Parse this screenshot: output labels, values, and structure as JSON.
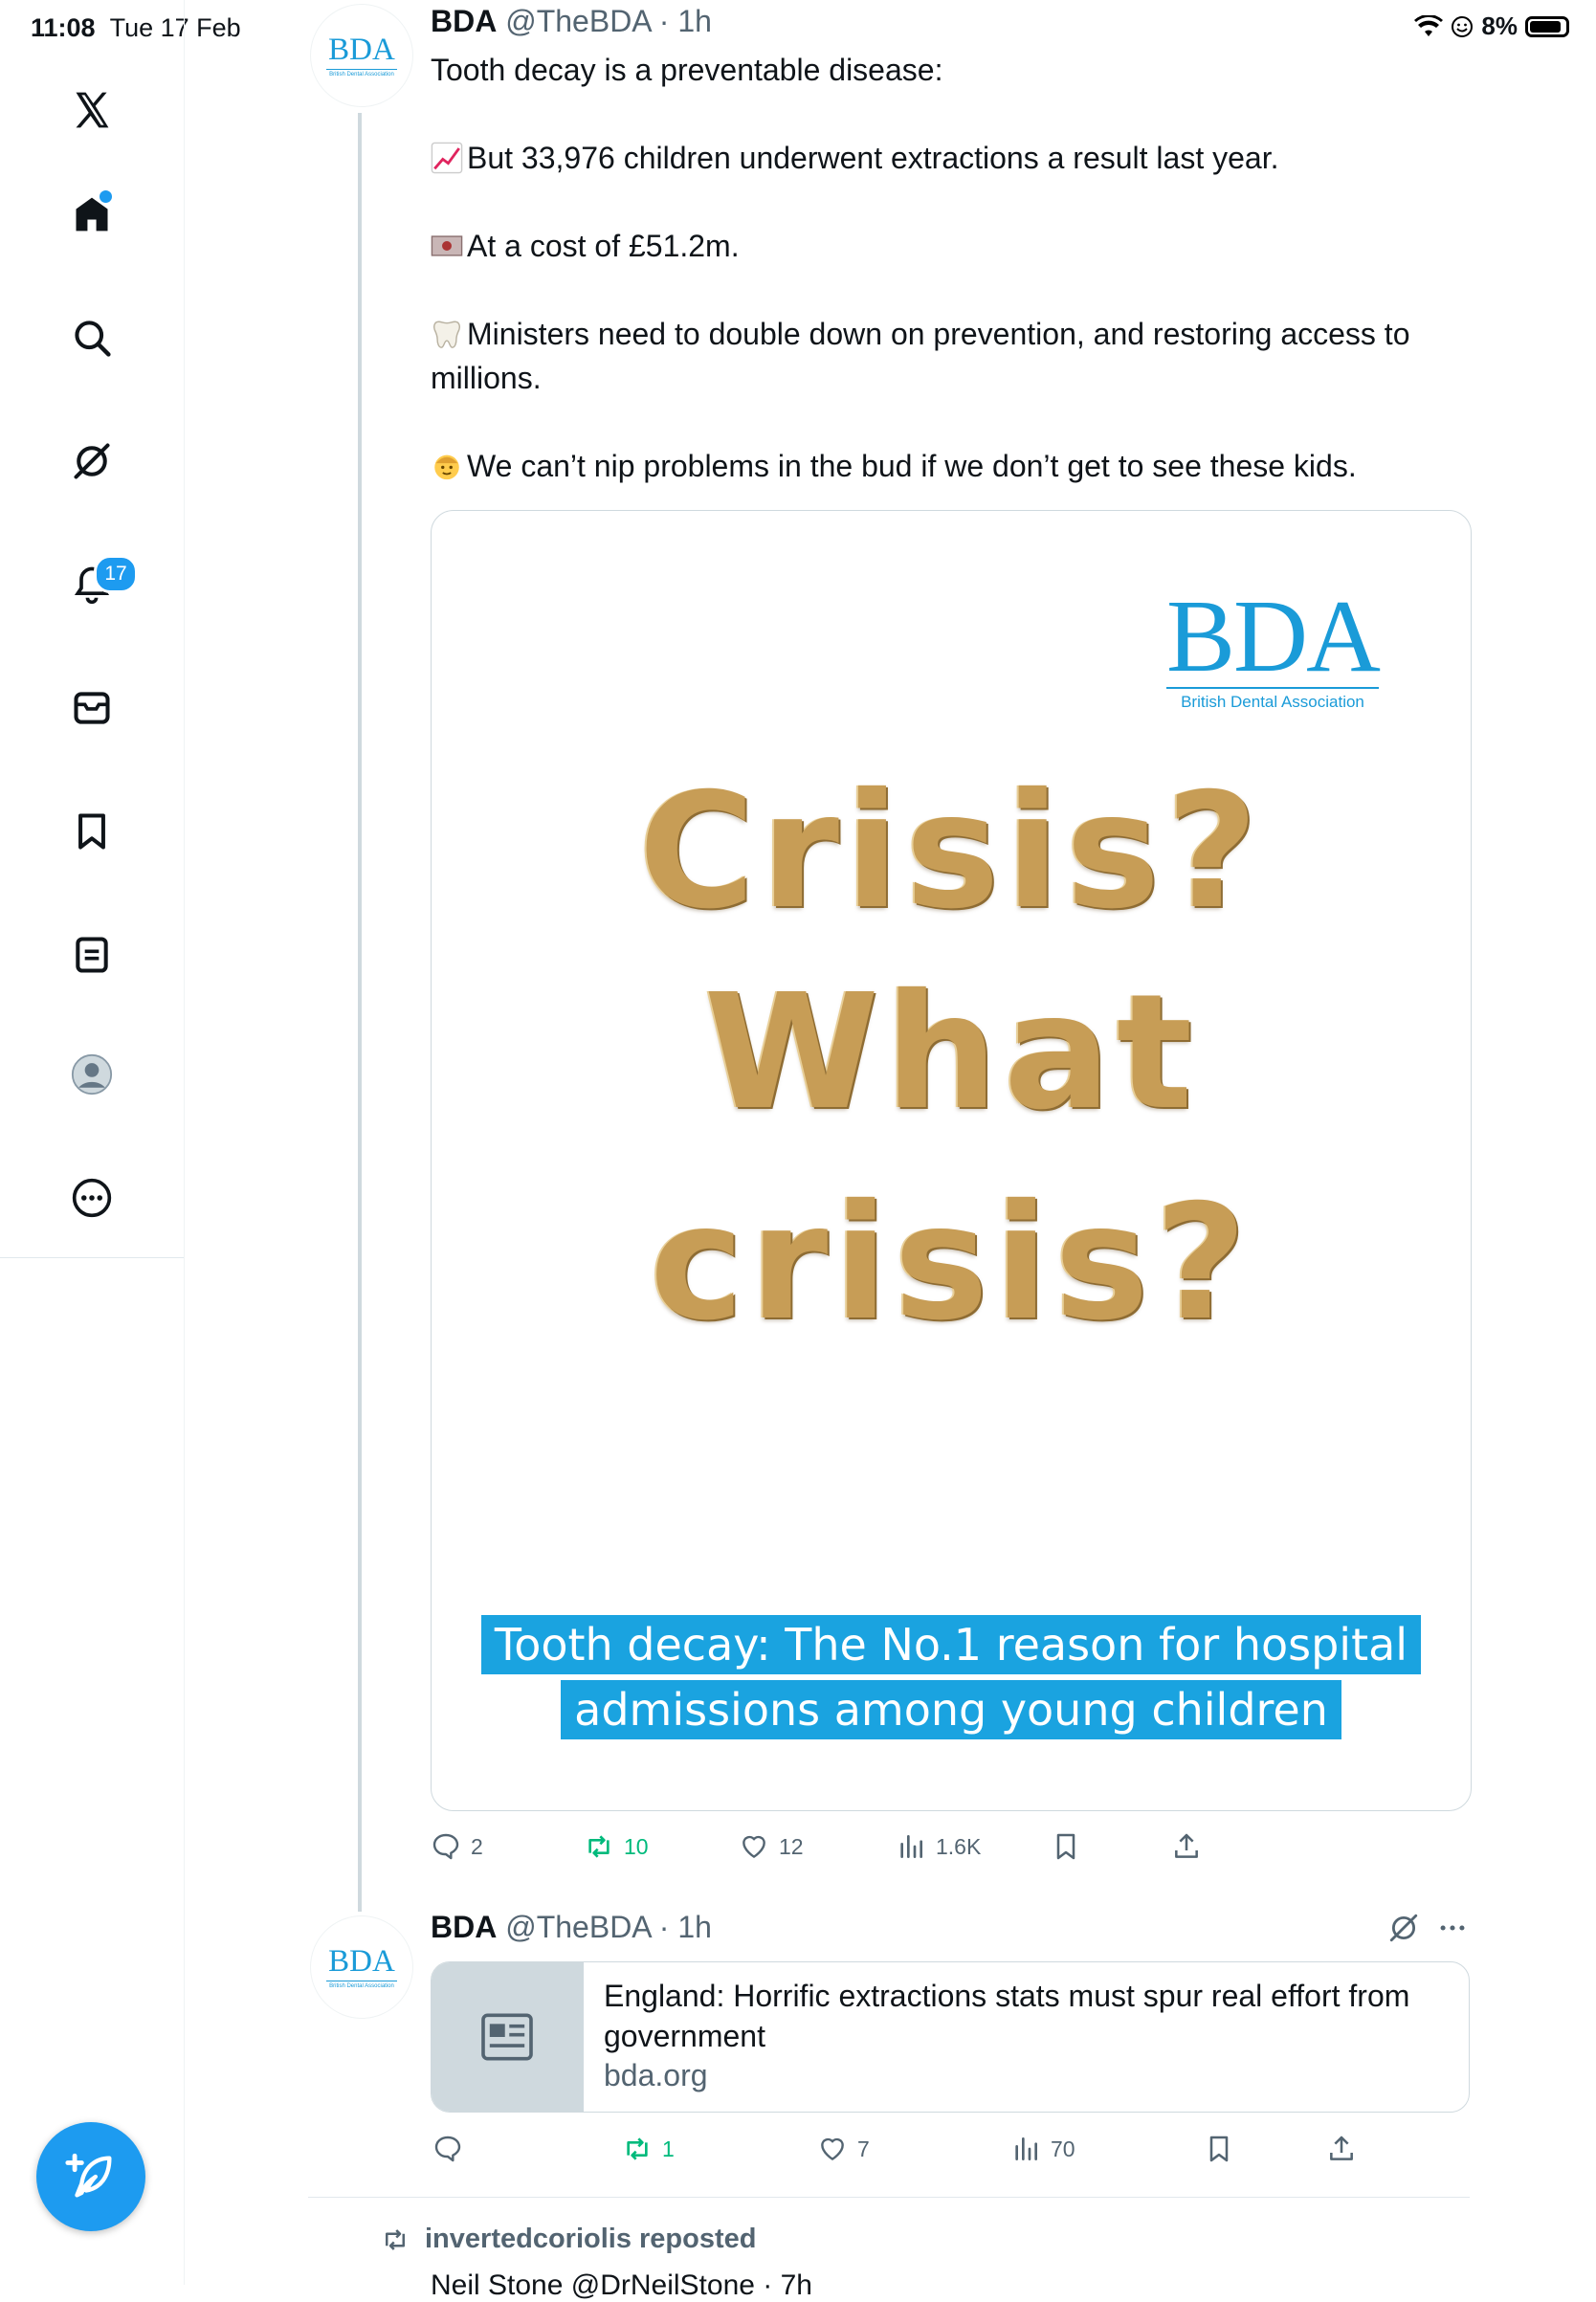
{
  "status_bar": {
    "time": "11:08",
    "date": "Tue 17 Feb",
    "battery_text": "8%"
  },
  "sidebar": {
    "items": [
      {
        "name": "x-logo-icon"
      },
      {
        "name": "home-icon"
      },
      {
        "name": "search-icon"
      },
      {
        "name": "grok-icon"
      },
      {
        "name": "notifications-icon"
      },
      {
        "name": "messages-icon"
      },
      {
        "name": "bookmarks-icon"
      },
      {
        "name": "lists-icon"
      },
      {
        "name": "profile-icon"
      },
      {
        "name": "more-icon"
      }
    ],
    "notifications_badge": "17"
  },
  "tweet1": {
    "author_name": "BDA",
    "handle_time": "@TheBDA · 1h",
    "avatar_logo": "BDA",
    "avatar_sub": "British Dental Association",
    "lines": {
      "l1": "Tooth decay is a preventable disease:",
      "l2": "But 33,976 children underwent extractions a result last year.",
      "l3": "At a cost of £51.2m.",
      "l4": "Ministers need to double down on prevention, and restoring access to millions.",
      "l5": "We can’t nip problems in the bud if we don’t get to see these kids."
    },
    "image": {
      "logo_big": "BDA",
      "logo_small": "British Dental Association",
      "word1": "Crisis?",
      "word2": "What",
      "word3": "crisis?",
      "banner1": "Tooth decay: The No.1 reason for hospital",
      "banner2": "admissions among young children"
    },
    "actions": {
      "replies": "2",
      "reposts": "10",
      "likes": "12",
      "views": "1.6K"
    }
  },
  "tweet2": {
    "author_name": "BDA",
    "handle_time": "@TheBDA · 1h",
    "avatar_logo": "BDA",
    "avatar_sub": "British Dental Association",
    "link": {
      "title": "England: Horrific extractions stats must spur real effort from government",
      "domain": "bda.org"
    },
    "actions": {
      "replies": "",
      "reposts": "1",
      "likes": "7",
      "views": "70"
    }
  },
  "repost_notice": "invertedcoriolis reposted",
  "next_tweet_partial": "Neil Stone  @DrNeilStone · 7h",
  "colors": {
    "accent": "#1d9bf0",
    "repost_green": "#00ba7c",
    "bda_blue": "#1a9bd8",
    "banner_blue": "#1aa3e0"
  }
}
